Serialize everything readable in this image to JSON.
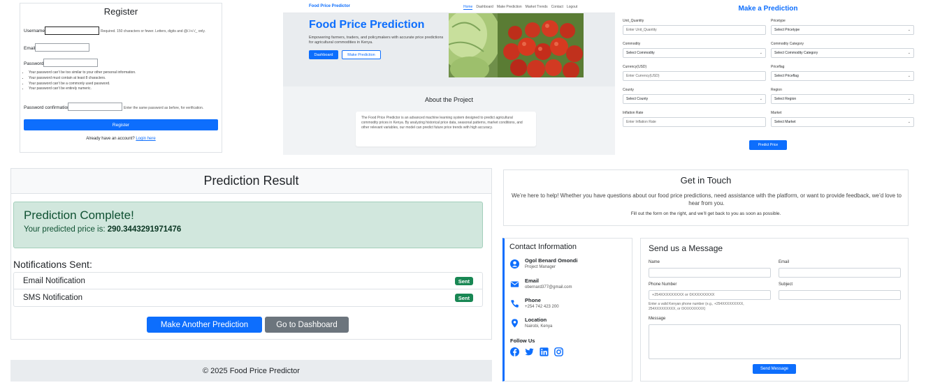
{
  "register": {
    "title": "Register",
    "username_label": "Username",
    "username_help": "Required. 150 characters or fewer. Letters, digits and @/./+/-/_ only.",
    "email_label": "Email",
    "password_label": "Password",
    "password_rules": [
      "Your password can’t be too similar to your other personal information.",
      "Your password must contain at least 8 characters.",
      "Your password can’t be a commonly used password.",
      "Your password can’t be entirely numeric."
    ],
    "confirm_label": "Password confirmation",
    "confirm_help": "Enter the same password as before, for verification.",
    "button": "Register",
    "already_text": "Already have an account?",
    "login_link": "Login here"
  },
  "landing": {
    "brand": "Food Price Predictor",
    "nav": [
      "Home",
      "Dashboard",
      "Make Prediction",
      "Market Trends",
      "Contact",
      "Logout"
    ],
    "hero_title": "Food Price Prediction",
    "hero_subtitle": "Empowering farmers, traders, and policymakers with accurate price predictions for agricultural commodities in Kenya.",
    "btn_dashboard": "Dashboard",
    "btn_make_prediction": "Make Prediction",
    "about_title": "About the Project",
    "about_text": "The Food Price Predictor is an advanced machine learning system designed to predict agricultural commodity prices in Kenya. By analyzing historical price data, seasonal patterns, market conditions, and other relevant variables, our model can predict future price trends with high accuracy."
  },
  "make_prediction": {
    "title": "Make a Prediction",
    "fields": {
      "unit_quantity": {
        "label": "Unit_Quantity",
        "placeholder": "Enter Unit_Quantity"
      },
      "pricetype": {
        "label": "Pricetype",
        "value": "Select Pricetype"
      },
      "commodity": {
        "label": "Commodity",
        "value": "Select Commodity"
      },
      "commodity_category": {
        "label": "Commodity Category",
        "value": "Select Commodity Category"
      },
      "currency": {
        "label": "Currency(USD)",
        "placeholder": "Enter Currency(USD)"
      },
      "priceflag": {
        "label": "Priceflag",
        "value": "Select Priceflag"
      },
      "county": {
        "label": "County",
        "value": "Select County"
      },
      "region": {
        "label": "Region",
        "value": "Select Region"
      },
      "inflation_rate": {
        "label": "Inflation Rate",
        "placeholder": "Enter Inflation Rate"
      },
      "market": {
        "label": "Market",
        "value": "Select Market"
      }
    },
    "button": "Predict Price"
  },
  "result": {
    "header": "Prediction Result",
    "alert_title": "Prediction Complete!",
    "alert_text": "Your predicted price is:",
    "predicted_price": "290.3443291971476",
    "notifications_title": "Notifications Sent:",
    "notifications": [
      {
        "label": "Email Notification",
        "status": "Sent"
      },
      {
        "label": "SMS Notification",
        "status": "Sent"
      }
    ],
    "btn_another": "Make Another Prediction",
    "btn_dashboard": "Go to Dashboard",
    "footer": "© 2025 Food Price Predictor"
  },
  "contact": {
    "title": "Get in Touch",
    "intro": "We’re here to help! Whether you have questions about our food price predictions, need assistance with the platform, or want to provide feedback, we’d love to hear from you.",
    "small": "Fill out the form on the right, and we’ll get back to you as soon as possible.",
    "info_title": "Contact Information",
    "items": [
      {
        "title": "Ogol Benard Omondi",
        "sub": "Project Manager",
        "icon": "user-icon"
      },
      {
        "title": "Email",
        "sub": "obernard377@gmail.com",
        "icon": "envelope-icon"
      },
      {
        "title": "Phone",
        "sub": "+254 742 423 200",
        "icon": "phone-icon"
      },
      {
        "title": "Location",
        "sub": "Nairobi, Kenya",
        "icon": "map-pin-icon"
      }
    ],
    "follow": "Follow Us",
    "form": {
      "title": "Send us a Message",
      "name_label": "Name",
      "email_label": "Email",
      "phone_label": "Phone Number",
      "phone_placeholder": "+254XXXXXXXXX or 0XXXXXXXXX",
      "phone_help": "Enter a valid Kenyan phone number (e.g., +254XXXXXXXXX, 254XXXXXXXXX, or 0XXXXXXXXX)",
      "subject_label": "Subject",
      "message_label": "Message",
      "button": "Send Message"
    }
  },
  "colors": {
    "primary": "#0d6efd",
    "success": "#198754",
    "secondary": "#6c757d",
    "alert_bg": "#d1e7dd"
  }
}
